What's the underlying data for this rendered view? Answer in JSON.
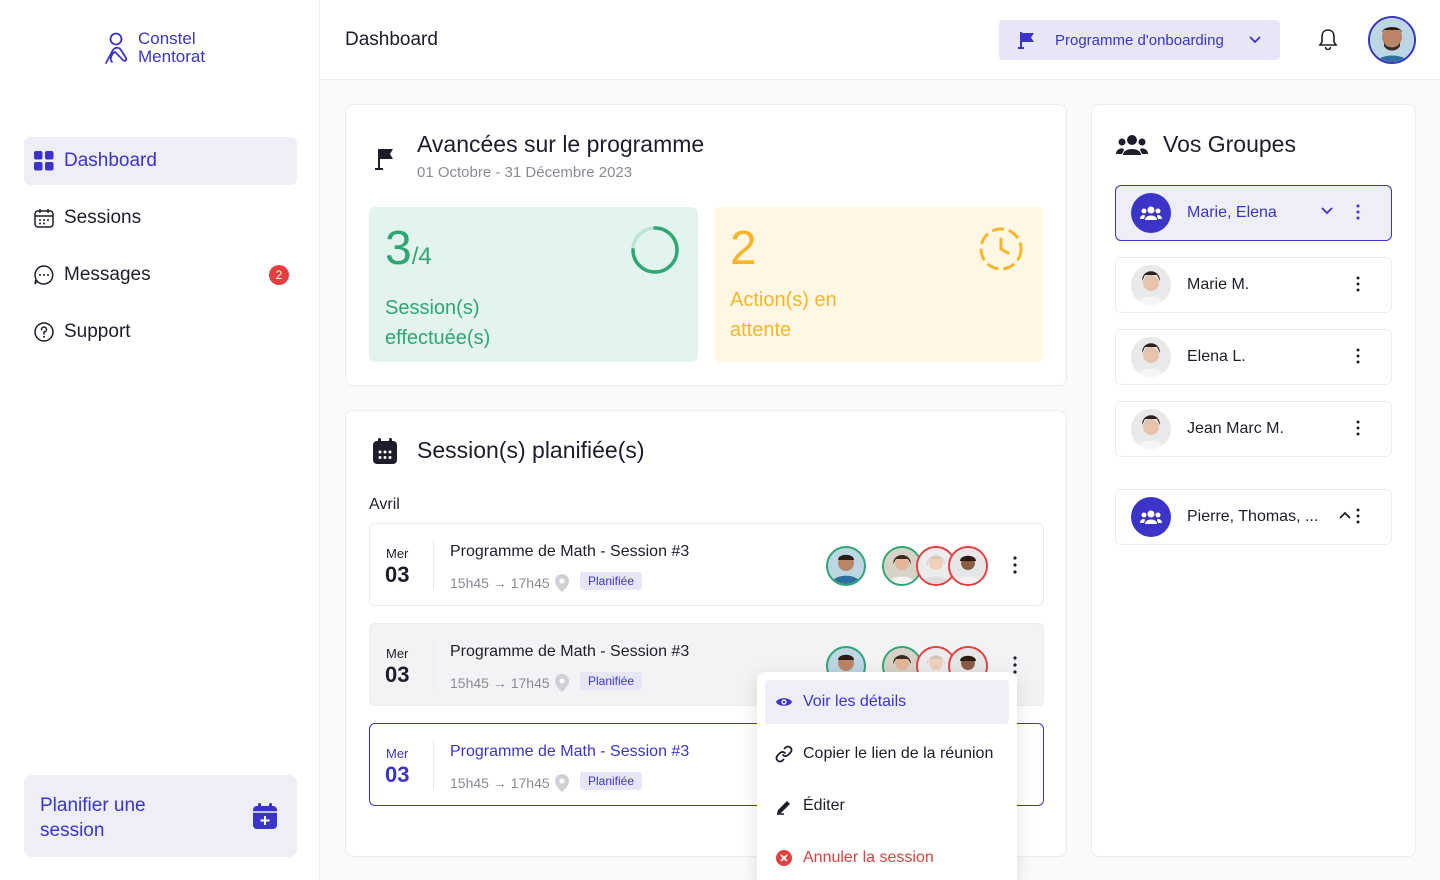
{
  "app": {
    "logo_line1": "Constel",
    "logo_line2": "Mentorat"
  },
  "sidebar": {
    "items": [
      {
        "label": "Dashboard",
        "icon": "grid-icon",
        "active": true
      },
      {
        "label": "Sessions",
        "icon": "calendar-icon"
      },
      {
        "label": "Messages",
        "icon": "chat-icon",
        "badge": "2"
      },
      {
        "label": "Support",
        "icon": "help-icon"
      }
    ],
    "plan_button": "Planifier une session"
  },
  "header": {
    "title": "Dashboard",
    "program_select": "Programme d'onboarding"
  },
  "progress": {
    "title": "Avancées sur le programme",
    "period": "01 Octobre - 31 Décembre 2023",
    "done_value": "3",
    "done_total": "/4",
    "done_label": "Session(s) effectuée(s)",
    "pending_value": "2",
    "pending_label": "Action(s) en attente"
  },
  "sessions": {
    "title": "Session(s) planifiée(s)",
    "month": "Avril",
    "items": [
      {
        "day": "Mer",
        "date": "03",
        "title": "Programme de Math - Session  #3",
        "time": "15h45 → 17h45",
        "status": "Planifiée"
      },
      {
        "day": "Mer",
        "date": "03",
        "title": "Programme de Math - Session  #3",
        "time": "15h45 → 17h45",
        "status": "Planifiée"
      },
      {
        "day": "Mer",
        "date": "03",
        "title": "Programme de Math - Session  #3",
        "time": "15h45 → 17h45",
        "status": "Planifiée"
      }
    ]
  },
  "menu": {
    "view": "Voir les détails",
    "copy": "Copier le lien de la réunion",
    "edit": "Éditer",
    "cancel": "Annuler la session"
  },
  "groups": {
    "title": "Vos Groupes",
    "items": [
      {
        "name": "Marie, Elena",
        "type": "group"
      },
      {
        "name": "Marie M.",
        "type": "person"
      },
      {
        "name": "Elena L.",
        "type": "person"
      },
      {
        "name": "Jean Marc M.",
        "type": "person"
      },
      {
        "name": "Pierre, Thomas, ...",
        "type": "group"
      }
    ]
  },
  "colors": {
    "accent": "#3b34c9",
    "success": "#2fa673",
    "warning": "#f5b62a",
    "danger": "#e53e3e"
  }
}
